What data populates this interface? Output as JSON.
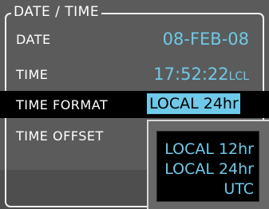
{
  "panel": {
    "title": "DATE / TIME"
  },
  "rows": {
    "date": {
      "label": "DATE",
      "value": "08-FEB-08"
    },
    "time": {
      "label": "TIME",
      "value": "17:52:22",
      "suffix": "LCL"
    },
    "time_format": {
      "label": "TIME FORMAT",
      "value": "LOCAL 24hr"
    },
    "time_offset": {
      "label": "TIME OFFSET"
    }
  },
  "dropdown": {
    "options": [
      "LOCAL 12hr",
      "LOCAL 24hr",
      "UTC"
    ]
  },
  "colors": {
    "background": "#5b5b5b",
    "value_cyan": "#6fc9e8",
    "selection_bg": "#000000",
    "text_white": "#ffffff"
  }
}
